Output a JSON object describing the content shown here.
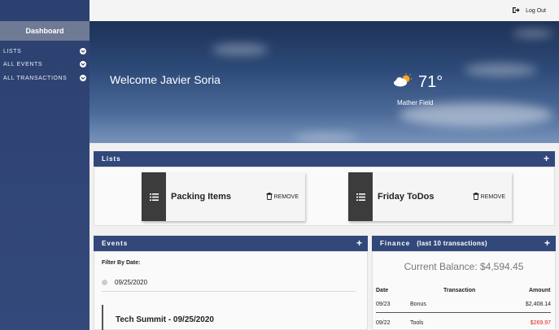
{
  "sidebar": {
    "title": "Dashboard",
    "items": [
      {
        "label": "LISTS"
      },
      {
        "label": "ALL EVENTS"
      },
      {
        "label": "ALL TRANSACTIONS"
      }
    ]
  },
  "topbar": {
    "logout_label": "Log Out"
  },
  "hero": {
    "welcome": "Welcome Javier Soria",
    "temperature": "71°",
    "location": "Mather Field",
    "weather_icon": "partly-cloudy-icon"
  },
  "lists": {
    "header": "Lists",
    "add_label": "+",
    "cards": [
      {
        "title": "Packing Items",
        "remove_label": "REMOVE"
      },
      {
        "title": "Friday ToDos",
        "remove_label": "REMOVE"
      }
    ]
  },
  "events": {
    "header": "Events",
    "add_label": "+",
    "filter_label": "Filter By Date:",
    "filter_date": "09/25/2020",
    "event_title": "Tech Summit - 09/25/2020"
  },
  "finance": {
    "header": "Finance",
    "subheader": "(last 10 transactions)",
    "add_label": "+",
    "balance": "Current Balance: $4,594.45",
    "columns": [
      "Date",
      "Transaction",
      "Amount"
    ],
    "rows": [
      {
        "date": "09/23",
        "transaction": "Bonus",
        "amount": "$2,408.14"
      },
      {
        "date": "09/22",
        "transaction": "Tools",
        "amount": "$269.97"
      }
    ]
  },
  "colors": {
    "sidebar": "#2d4170",
    "panel_header": "#33487a",
    "negative_amount": "#e02020"
  }
}
